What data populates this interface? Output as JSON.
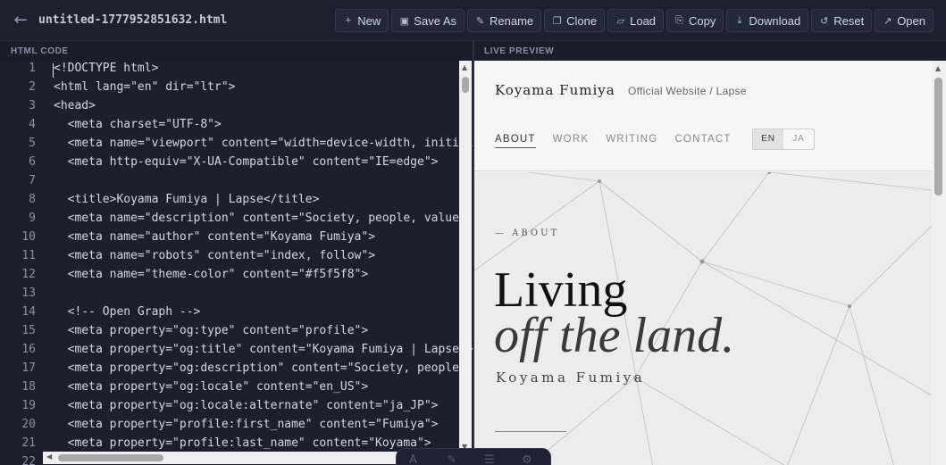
{
  "header": {
    "back_icon": "arrow-left-icon",
    "filename": "untitled-1777952851632.html",
    "buttons": [
      {
        "icon": "+",
        "label": "New"
      },
      {
        "icon": "▣",
        "label": "Save As"
      },
      {
        "icon": "✎",
        "label": "Rename"
      },
      {
        "icon": "❐",
        "label": "Clone"
      },
      {
        "icon": "▱",
        "label": "Load"
      },
      {
        "icon": "⎘",
        "label": "Copy"
      },
      {
        "icon": "⤓",
        "label": "Download"
      },
      {
        "icon": "↺",
        "label": "Reset"
      },
      {
        "icon": "↗",
        "label": "Open"
      }
    ]
  },
  "panels": {
    "code_title": "HTML CODE",
    "preview_title": "LIVE PREVIEW"
  },
  "code": {
    "line_numbers": [
      "1",
      "2",
      "3",
      "4",
      "5",
      "6",
      "7",
      "8",
      "9",
      "10",
      "11",
      "12",
      "13",
      "14",
      "15",
      "16",
      "17",
      "18",
      "19",
      "20",
      "21",
      "22"
    ],
    "lines": [
      "<!DOCTYPE html>",
      "<html lang=\"en\" dir=\"ltr\">",
      "<head>",
      "  <meta charset=\"UTF-8\">",
      "  <meta name=\"viewport\" content=\"width=device-width, initial",
      "  <meta http-equiv=\"X-UA-Compatible\" content=\"IE=edge\">",
      "",
      "  <title>Koyama Fumiya | Lapse</title>",
      "  <meta name=\"description\" content=\"Society, people, value.",
      "  <meta name=\"author\" content=\"Koyama Fumiya\">",
      "  <meta name=\"robots\" content=\"index, follow\">",
      "  <meta name=\"theme-color\" content=\"#f5f5f8\">",
      "",
      "  <!-- Open Graph -->",
      "  <meta property=\"og:type\" content=\"profile\">",
      "  <meta property=\"og:title\" content=\"Koyama Fumiya | Lapse\">",
      "  <meta property=\"og:description\" content=\"Society, people,",
      "  <meta property=\"og:locale\" content=\"en_US\">",
      "  <meta property=\"og:locale:alternate\" content=\"ja_JP\">",
      "  <meta property=\"profile:first_name\" content=\"Fumiya\">",
      "  <meta property=\"profile:last_name\" content=\"Koyama\">",
      ""
    ]
  },
  "preview": {
    "brand": "Koyama Fumiya",
    "subtitle": "Official Website / Lapse",
    "nav": [
      "ABOUT",
      "WORK",
      "WRITING",
      "CONTACT"
    ],
    "lang": [
      "EN",
      "JA"
    ],
    "eyebrow": "— ABOUT",
    "title_line1": "Living",
    "title_line2": "off the land.",
    "author": "Koyama Fumiya"
  },
  "dock": {
    "icons": [
      "text-icon",
      "brush-icon",
      "menu-icon",
      "settings-icon"
    ]
  }
}
